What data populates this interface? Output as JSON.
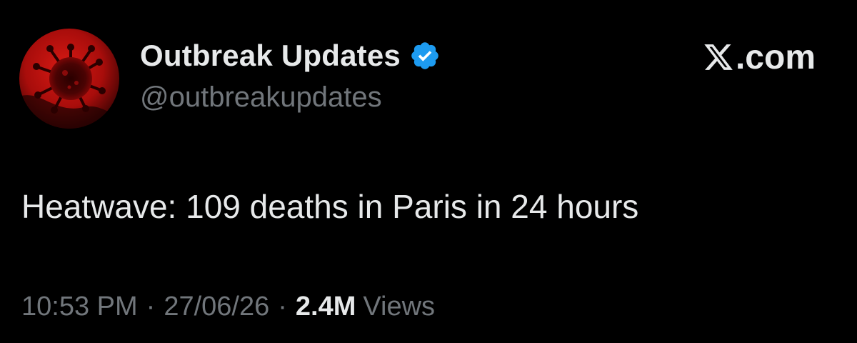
{
  "account": {
    "display_name": "Outbreak Updates",
    "handle": "@outbreakupdates",
    "verified": true,
    "verified_color": "#1d9bf0",
    "avatar_icon": "virus-icon",
    "avatar_colors": [
      "#c41212",
      "#1a0000"
    ]
  },
  "brand": {
    "label": ".com",
    "logo_icon": "x-logo-icon"
  },
  "tweet": {
    "text": "Heatwave: 109 deaths in Paris in 24 hours"
  },
  "meta": {
    "time": "10:53 PM",
    "separator": "·",
    "date": "27/06/26",
    "views_count": "2.4M",
    "views_label": "Views"
  },
  "colors": {
    "background": "#000000",
    "primary_text": "#e7e9ea",
    "secondary_text": "#71767b"
  }
}
